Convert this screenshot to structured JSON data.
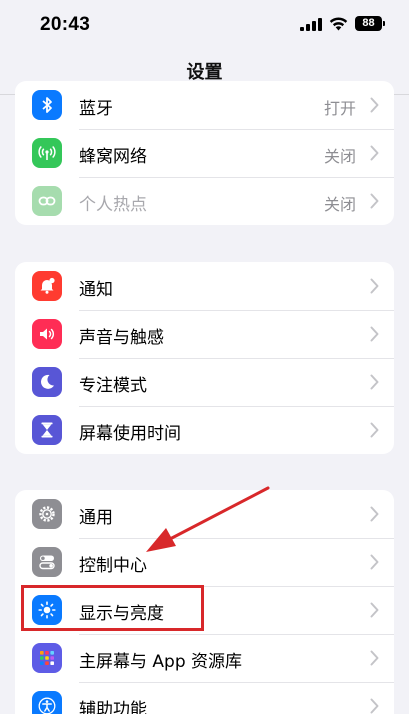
{
  "status_bar": {
    "time": "20:43",
    "battery": "88"
  },
  "nav": {
    "title": "设置"
  },
  "groups": [
    {
      "rows": [
        {
          "label": "蓝牙",
          "value": "打开",
          "icon": "bluetooth-icon",
          "color": "#0a7aff"
        },
        {
          "label": "蜂窝网络",
          "value": "关闭",
          "icon": "cellular-icon",
          "color": "#34c759"
        },
        {
          "label": "个人热点",
          "value": "关闭",
          "icon": "hotspot-icon",
          "color": "#a6dcae"
        }
      ]
    },
    {
      "rows": [
        {
          "label": "通知",
          "icon": "bell-icon",
          "color": "#ff3b30"
        },
        {
          "label": "声音与触感",
          "icon": "speaker-icon",
          "color": "#ff2d55"
        },
        {
          "label": "专注模式",
          "icon": "moon-icon",
          "color": "#5856d6"
        },
        {
          "label": "屏幕使用时间",
          "icon": "hourglass-icon",
          "color": "#5856d6"
        }
      ]
    },
    {
      "rows": [
        {
          "label": "通用",
          "icon": "gear-icon",
          "color": "#8e8e93"
        },
        {
          "label": "控制中心",
          "icon": "toggles-icon",
          "color": "#8e8e93"
        },
        {
          "label": "显示与亮度",
          "icon": "sun-icon",
          "color": "#0a7aff"
        },
        {
          "label": "主屏幕与 App 资源库",
          "icon": "grid-icon",
          "color": "#5e5ce6"
        },
        {
          "label": "辅助功能",
          "icon": "accessibility-icon",
          "color": "#0a7aff"
        }
      ]
    }
  ],
  "annotation": {
    "highlight_color": "#d8282a",
    "target": "显示与亮度"
  }
}
